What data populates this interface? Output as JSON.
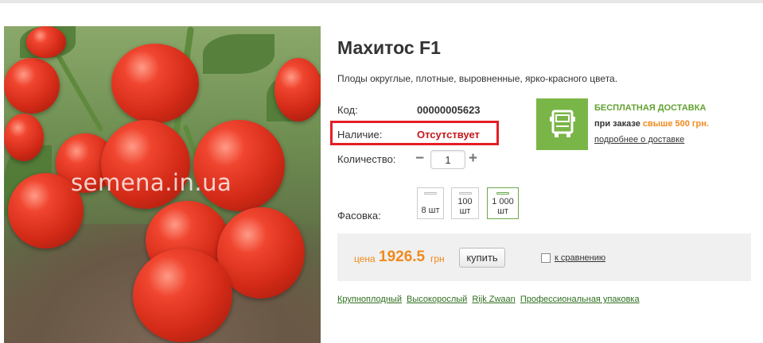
{
  "product": {
    "title": "Махитос F1",
    "description": "Плоды округлые, плотные, выровненные, ярко-красного цвета.",
    "image_watermark": "semena.in.ua"
  },
  "details": {
    "code_label": "Код:",
    "code_value": "00000005623",
    "stock_label": "Наличие:",
    "stock_value": "Отсутствует",
    "qty_label": "Количество:",
    "qty_value": "1",
    "qty_minus": "−",
    "qty_plus": "+",
    "pack_label": "Фасовка:",
    "packs": [
      {
        "label": "8 шт",
        "selected": false
      },
      {
        "label_top": "100",
        "label_bottom": "шт",
        "selected": false
      },
      {
        "label_top": "1 000",
        "label_bottom": "шт",
        "selected": true
      }
    ]
  },
  "delivery": {
    "icon": "truck-icon",
    "title": "БЕСПЛАТНАЯ ДОСТАВКА",
    "condition_prefix": "при заказе",
    "condition_highlight": "свыше 500 грн.",
    "link": "подробнее о доставке"
  },
  "buy": {
    "price_label": "цена",
    "price_value": "1926.5",
    "currency": "грн",
    "buy_button": "купить",
    "compare_label": "к сравнению",
    "compare_checked": false
  },
  "tags": [
    "Крупноплодный",
    "Высокорослый",
    "Rijk Zwaan",
    "Профессиональная упаковка"
  ],
  "colors": {
    "accent_green": "#7ab547",
    "price_orange": "#f08a1c",
    "stock_red": "#c4171d",
    "highlight_border": "#e41e26"
  }
}
